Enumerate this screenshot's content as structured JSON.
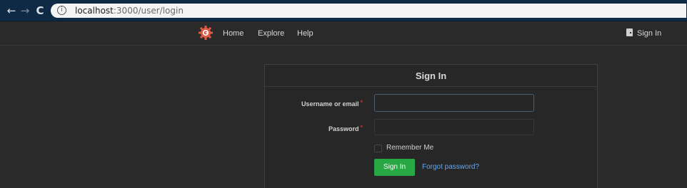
{
  "browser": {
    "back_icon": "back-arrow-icon",
    "forward_icon": "forward-arrow-icon",
    "reload_icon": "reload-icon",
    "url_host": "localhost",
    "url_path": ":3000/user/login"
  },
  "header": {
    "nav_items": [
      "Home",
      "Explore",
      "Help"
    ],
    "signin_label": "Sign In",
    "logo_color": "#e05a43"
  },
  "login": {
    "title": "Sign In",
    "username_label": "Username or email",
    "password_label": "Password",
    "required_marker": "*",
    "username_value": "",
    "password_value": "",
    "remember_label": "Remember Me",
    "remember_checked": false,
    "submit_label": "Sign In",
    "forgot_label": "Forgot password?"
  },
  "colors": {
    "primary_button": "#28a745",
    "link": "#6aa6e8",
    "background": "#2b2b2b"
  }
}
